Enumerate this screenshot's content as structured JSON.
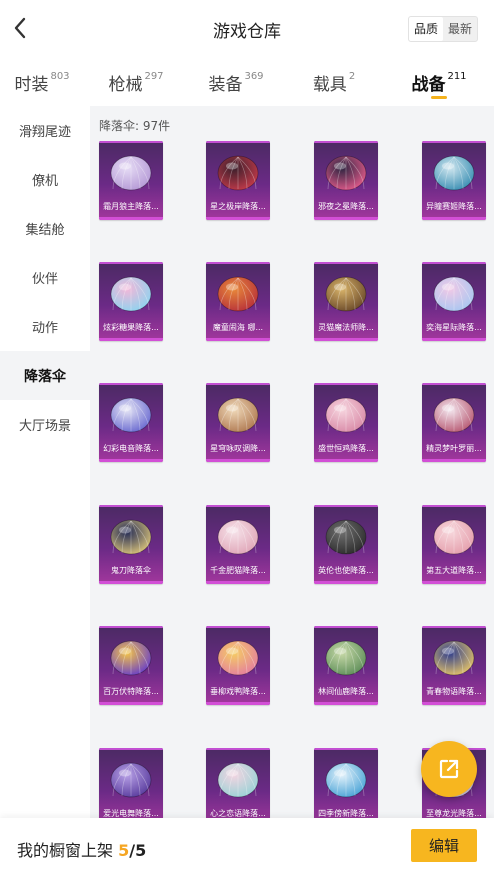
{
  "header": {
    "title": "游戏仓库",
    "sort_options": [
      {
        "label": "品质",
        "active": true
      },
      {
        "label": "最新",
        "active": false
      }
    ]
  },
  "tabs": [
    {
      "label": "时装",
      "count": "803",
      "active": false
    },
    {
      "label": "枪械",
      "count": "297",
      "active": false
    },
    {
      "label": "装备",
      "count": "369",
      "active": false
    },
    {
      "label": "载具",
      "count": "2",
      "active": false
    },
    {
      "label": "战备",
      "count": "211",
      "active": true
    }
  ],
  "sidebar": {
    "items": [
      {
        "label": "滑翔尾迹",
        "active": false
      },
      {
        "label": "僚机",
        "active": false
      },
      {
        "label": "集结舱",
        "active": false
      },
      {
        "label": "伙伴",
        "active": false
      },
      {
        "label": "动作",
        "active": false
      },
      {
        "label": "降落伞",
        "active": true
      },
      {
        "label": "大厅场景",
        "active": false
      }
    ]
  },
  "content": {
    "count_label": "降落伞: 97件",
    "items": [
      {
        "label": "霜月狼主降落...",
        "icon": "feather-parachute-icon",
        "colors": [
          "#e6dcf5",
          "#b59ad6"
        ]
      },
      {
        "label": "星之极岸降落...",
        "icon": "dark-red-parachute-icon",
        "colors": [
          "#3a1f2b",
          "#c23a4a"
        ]
      },
      {
        "label": "邪夜之冕降落...",
        "icon": "dark-mask-parachute-icon",
        "colors": [
          "#2c2440",
          "#e05a8a"
        ]
      },
      {
        "label": "异瞳赛姬降落...",
        "icon": "blue-dome-parachute-icon",
        "colors": [
          "#cfe6ef",
          "#3b8fb3"
        ]
      },
      {
        "label": "炫彩糖果降落...",
        "icon": "candy-parachute-icon",
        "colors": [
          "#f3b7d8",
          "#8fd3ef"
        ]
      },
      {
        "label": "魔童闹海 哪...",
        "icon": "fire-parachute-icon",
        "colors": [
          "#e8893a",
          "#b8323a"
        ]
      },
      {
        "label": "灵猫魔法师降...",
        "icon": "gold-star-parachute-icon",
        "colors": [
          "#d9b46a",
          "#6b4a2a"
        ]
      },
      {
        "label": "奕海星际降落...",
        "icon": "pink-blue-parachute-icon",
        "colors": [
          "#f1c9e6",
          "#a9c7f1"
        ]
      },
      {
        "label": "幻彩电音降落...",
        "icon": "graffiti-parachute-icon",
        "colors": [
          "#e5e5f5",
          "#6a6ad0"
        ]
      },
      {
        "label": "星穹咏叹调降...",
        "icon": "cream-parachute-icon",
        "colors": [
          "#efd8b8",
          "#b07a52"
        ]
      },
      {
        "label": "盛世恒鸡降落...",
        "icon": "pink-lotus-parachute-icon",
        "colors": [
          "#f6d4de",
          "#d98aa7"
        ]
      },
      {
        "label": "精灵梦叶罗丽...",
        "icon": "wing-parachute-icon",
        "colors": [
          "#f3e7ef",
          "#b85a73"
        ]
      },
      {
        "label": "鬼刀降落伞",
        "icon": "ghost-blade-parachute-icon",
        "colors": [
          "#232a55",
          "#d8c27a"
        ]
      },
      {
        "label": "千金肥猫降落...",
        "icon": "cat-parachute-icon",
        "colors": [
          "#f6e2e9",
          "#e0a6b8"
        ]
      },
      {
        "label": "英伦也使降落...",
        "icon": "gray-wing-parachute-icon",
        "colors": [
          "#6f6f6f",
          "#2d2d2d"
        ]
      },
      {
        "label": "第五大道降落...",
        "icon": "pink-dome-parachute-icon",
        "colors": [
          "#f7d7dc",
          "#e5a0ad"
        ]
      },
      {
        "label": "百万伏特降落...",
        "icon": "lightning-parachute-icon",
        "colors": [
          "#f3c447",
          "#6a3fc8"
        ]
      },
      {
        "label": "垂柳戏鸭降落...",
        "icon": "yellow-parachute-icon",
        "colors": [
          "#f5cd63",
          "#e47f9e"
        ]
      },
      {
        "label": "林间仙鹿降落...",
        "icon": "green-parachute-icon",
        "colors": [
          "#c7d9a7",
          "#5f8f5a"
        ]
      },
      {
        "label": "青春物语降落...",
        "icon": "blue-gold-parachute-icon",
        "colors": [
          "#2f3d8c",
          "#e3c36a"
        ]
      },
      {
        "label": "爱光电舞降落...",
        "icon": "purple-flower-parachute-icon",
        "colors": [
          "#b7a0e6",
          "#5a3d9e"
        ]
      },
      {
        "label": "心之恋语降落...",
        "icon": "pastel-parachute-icon",
        "colors": [
          "#f3d4e1",
          "#9ad2d6"
        ]
      },
      {
        "label": "四季傍新降落...",
        "icon": "blue-white-parachute-icon",
        "colors": [
          "#e3f2fb",
          "#4aa3d6"
        ]
      },
      {
        "label": "至尊龙光降落...",
        "icon": "dragon-parachute-icon",
        "colors": [
          "#3a3f8c",
          "#e3d2f5"
        ]
      }
    ]
  },
  "footer": {
    "text_prefix": "我的橱窗上架",
    "shelf_used": "5",
    "separator": "/",
    "shelf_total": "5",
    "edit_label": "编辑"
  },
  "fab": {
    "icon": "share-export-icon"
  },
  "accent_color": "#f7b61f"
}
